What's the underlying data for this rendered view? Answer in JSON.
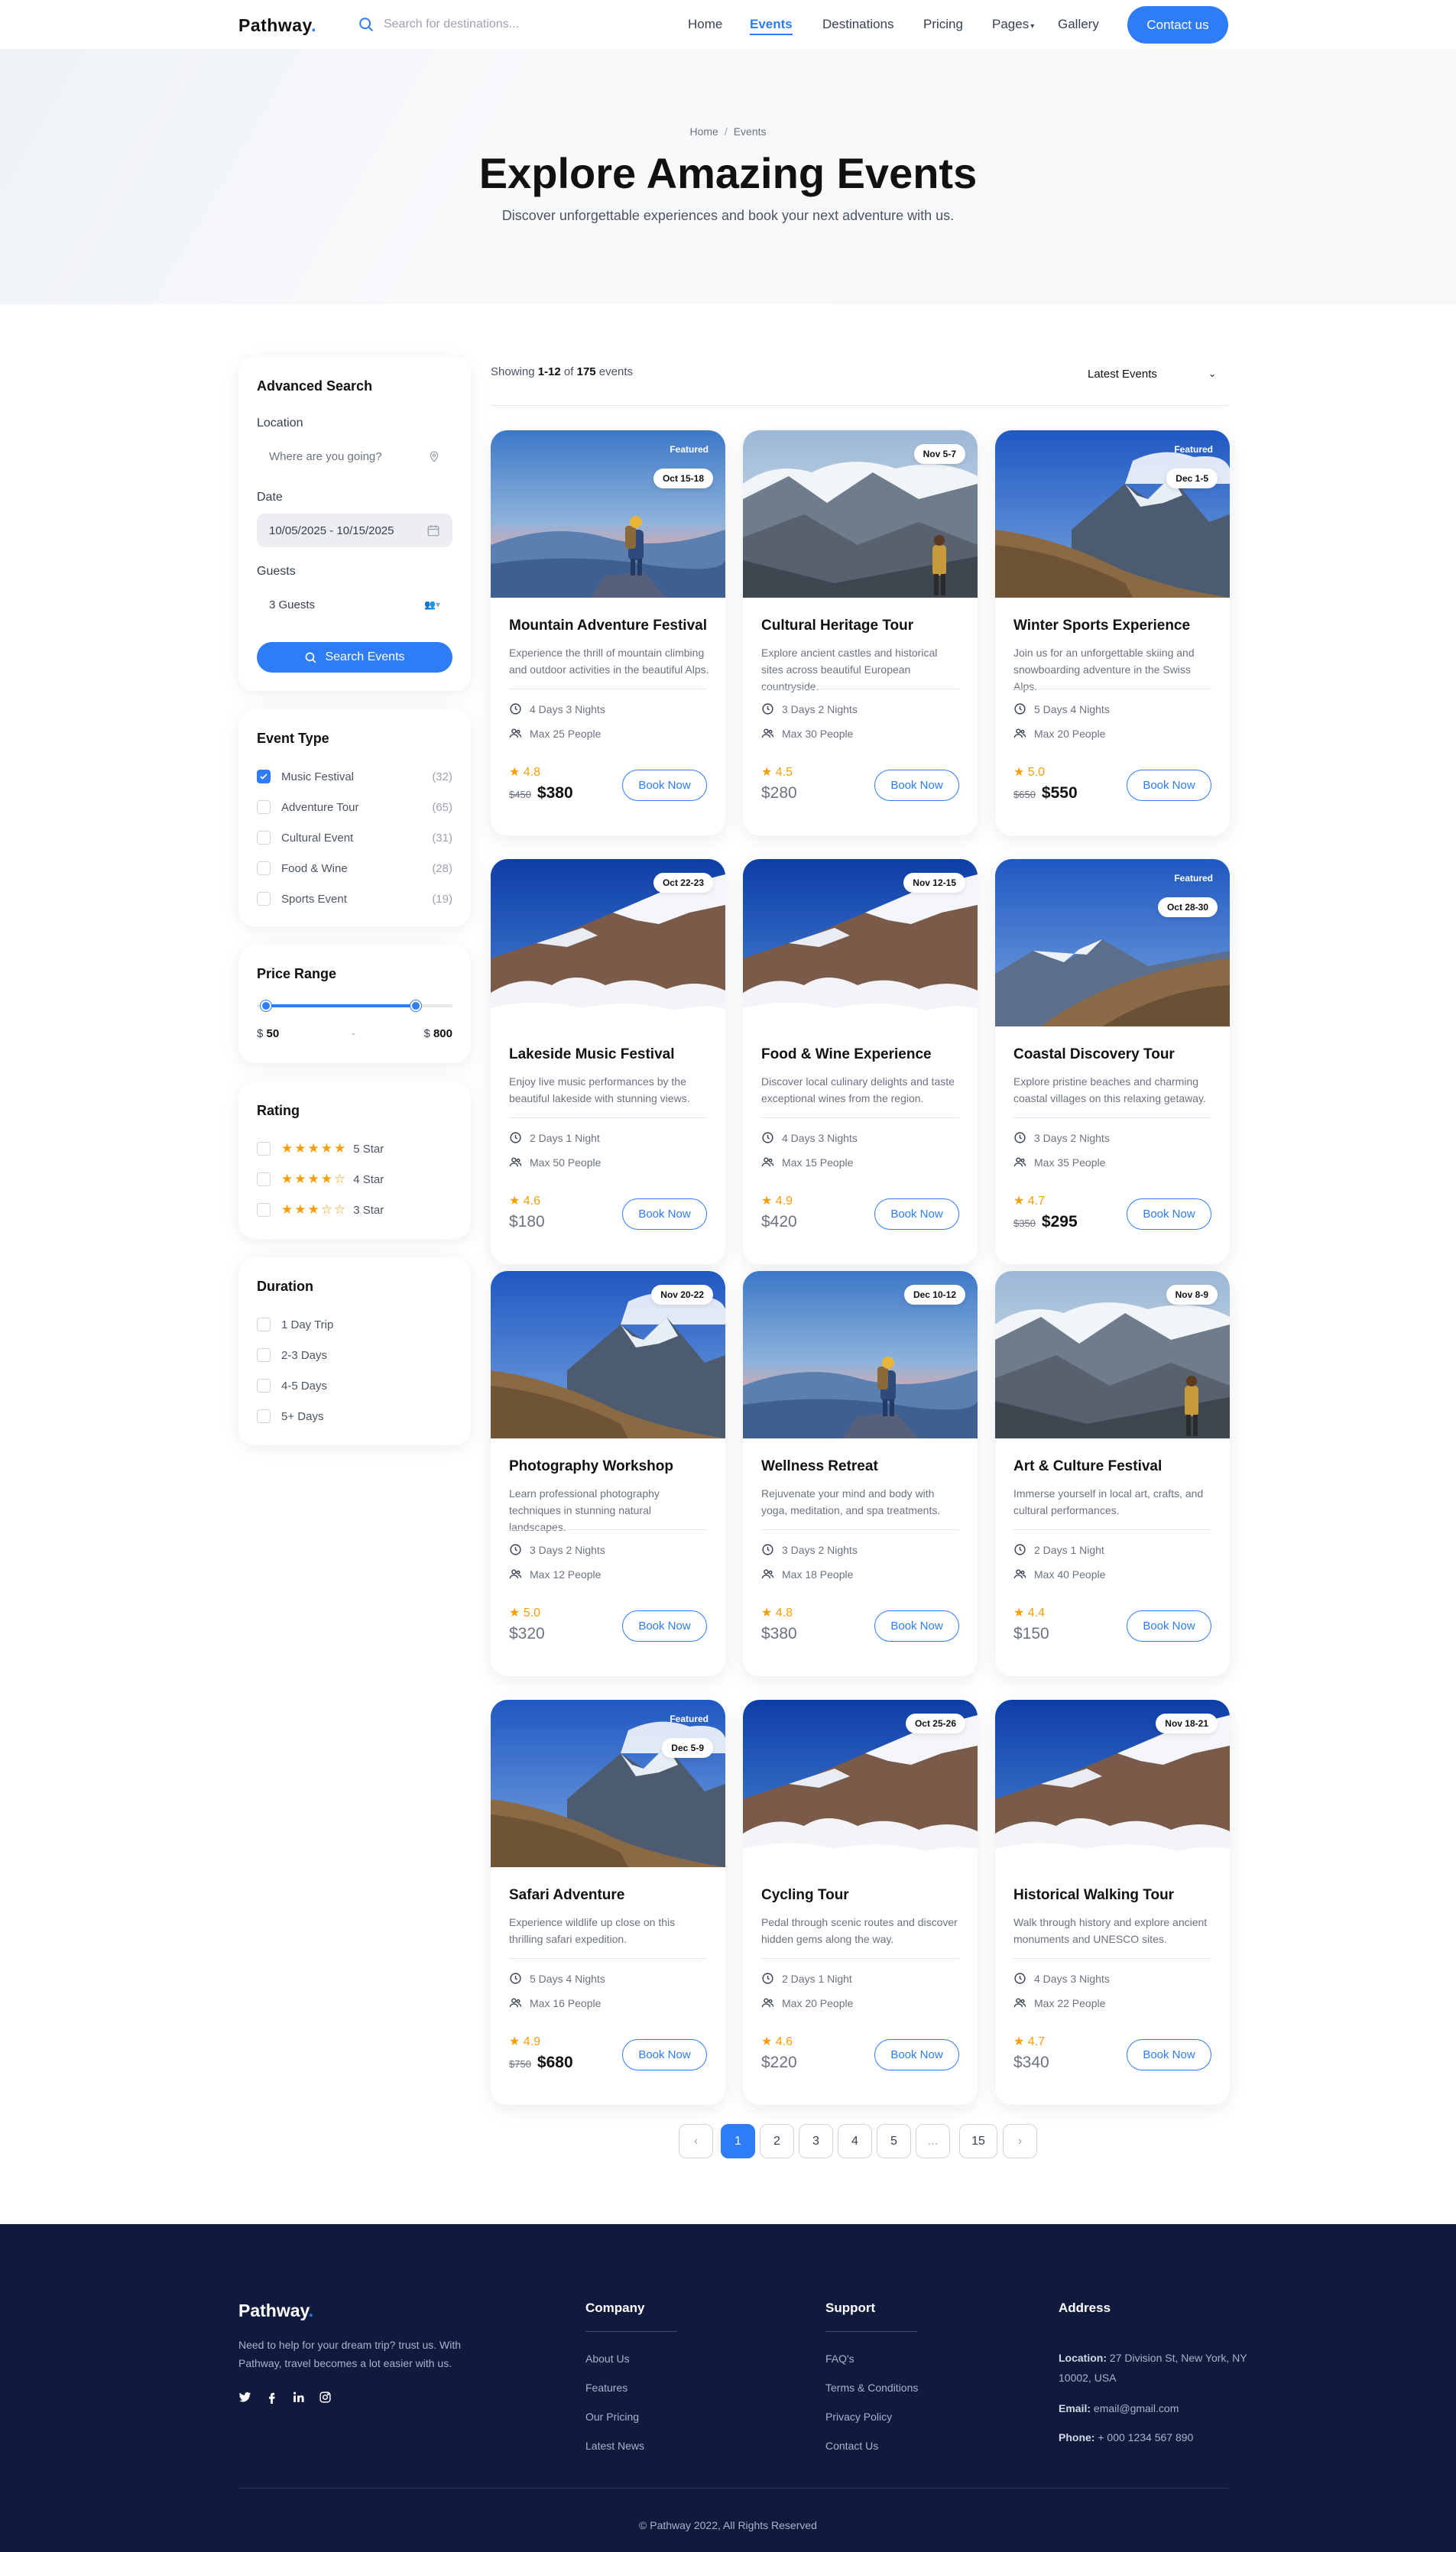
{
  "header": {
    "logo": "Pathway",
    "logo_dot": ".",
    "search_placeholder": "Search for destinations...",
    "nav": [
      "Home",
      "Events",
      "Destinations",
      "Pricing",
      "Pages",
      "Gallery"
    ],
    "contact_label": "Contact us"
  },
  "hero": {
    "breadcrumb_home": "Home",
    "breadcrumb_sep": "/",
    "breadcrumb_current": "Events",
    "title": "Explore Amazing Events",
    "subtitle": "Discover unforgettable experiences and book your next adventure with us."
  },
  "sidebar": {
    "search": {
      "title": "Advanced Search",
      "location_label": "Location",
      "location_placeholder": "Where are you going?",
      "date_label": "Date",
      "date_value": "10/05/2025 - 10/15/2025",
      "guests_label": "Guests",
      "guests_value": "3 Guests",
      "button": "Search Events"
    },
    "event_type": {
      "title": "Event Type",
      "items": [
        {
          "label": "Music Festival",
          "count": "(32)",
          "checked": true
        },
        {
          "label": "Adventure Tour",
          "count": "(65)",
          "checked": false
        },
        {
          "label": "Cultural Event",
          "count": "(31)",
          "checked": false
        },
        {
          "label": "Food & Wine",
          "count": "(28)",
          "checked": false
        },
        {
          "label": "Sports Event",
          "count": "(19)",
          "checked": false
        }
      ]
    },
    "price": {
      "title": "Price Range",
      "currency": "$",
      "min": "50",
      "max": "800",
      "dash": "-"
    },
    "rating": {
      "title": "Rating",
      "items": [
        {
          "label": "5 Star",
          "stars": 5
        },
        {
          "label": "4 Star",
          "stars": 4
        },
        {
          "label": "3 Star",
          "stars": 3
        }
      ]
    },
    "duration": {
      "title": "Duration",
      "items": [
        "1 Day Trip",
        "2-3 Days",
        "4-5 Days",
        "5+ Days"
      ]
    }
  },
  "results": {
    "showing_prefix": "Showing ",
    "range": "1-12",
    "of": " of ",
    "total": "175",
    "suffix": " events",
    "sort_value": "Latest Events"
  },
  "cards": [
    {
      "title": "Mountain Adventure Festival",
      "desc": "Experience the thrill of mountain climbing and outdoor activities in the beautiful Alps.",
      "date": "Oct 15-18",
      "featured": "Featured",
      "duration": "4 Days 3 Nights",
      "people": "Max 25 People",
      "rating": "4.8",
      "old_price": "$450",
      "price": "$380",
      "book": "Book Now",
      "img": "hiker-sunset"
    },
    {
      "title": "Cultural Heritage Tour",
      "desc": "Explore ancient castles and historical sites across beautiful European countryside.",
      "date": "Nov 5-7",
      "featured": "",
      "duration": "3 Days 2 Nights",
      "people": "Max 30 People",
      "rating": "4.5",
      "old_price": "",
      "price": "$280",
      "book": "Book Now",
      "img": "valley-hiker"
    },
    {
      "title": "Winter Sports Experience",
      "desc": "Join us for an unforgettable skiing and snowboarding adventure in the Swiss Alps.",
      "date": "Dec 1-5",
      "featured": "Featured",
      "duration": "5 Days 4 Nights",
      "people": "Max 20 People",
      "rating": "5.0",
      "old_price": "$650",
      "price": "$550",
      "book": "Book Now",
      "img": "peak-slope"
    },
    {
      "title": "Lakeside Music Festival",
      "desc": "Enjoy live music performances by the beautiful lakeside with stunning views.",
      "date": "Oct 22-23",
      "featured": "",
      "duration": "2 Days 1 Night",
      "people": "Max 50 People",
      "rating": "4.6",
      "old_price": "",
      "price": "$180",
      "book": "Book Now",
      "img": "snow-clouds"
    },
    {
      "title": "Food & Wine Experience",
      "desc": "Discover local culinary delights and taste exceptional wines from the region.",
      "date": "Nov 12-15",
      "featured": "",
      "duration": "4 Days 3 Nights",
      "people": "Max 15 People",
      "rating": "4.9",
      "old_price": "",
      "price": "$420",
      "book": "Book Now",
      "img": "snow-clouds"
    },
    {
      "title": "Coastal Discovery Tour",
      "desc": "Explore pristine beaches and charming coastal villages on this relaxing getaway.",
      "date": "Oct 28-30",
      "featured": "Featured",
      "duration": "3 Days 2 Nights",
      "people": "Max 35 People",
      "rating": "4.7",
      "old_price": "$350",
      "price": "$295",
      "book": "Book Now",
      "img": "ridge-blue"
    },
    {
      "title": "Photography Workshop",
      "desc": "Learn professional photography techniques in stunning natural landscapes.",
      "date": "Nov 20-22",
      "featured": "",
      "duration": "3 Days 2 Nights",
      "people": "Max 12 People",
      "rating": "5.0",
      "old_price": "",
      "price": "$320",
      "book": "Book Now",
      "img": "peak-slope"
    },
    {
      "title": "Wellness Retreat",
      "desc": "Rejuvenate your mind and body with yoga, meditation, and spa treatments.",
      "date": "Dec 10-12",
      "featured": "",
      "duration": "3 Days 2 Nights",
      "people": "Max 18 People",
      "rating": "4.8",
      "old_price": "",
      "price": "$380",
      "book": "Book Now",
      "img": "hiker-sunset"
    },
    {
      "title": "Art & Culture Festival",
      "desc": "Immerse yourself in local art, crafts, and cultural performances.",
      "date": "Nov 8-9",
      "featured": "",
      "duration": "2 Days 1 Night",
      "people": "Max 40 People",
      "rating": "4.4",
      "old_price": "",
      "price": "$150",
      "book": "Book Now",
      "img": "valley-hiker"
    },
    {
      "title": "Safari Adventure",
      "desc": "Experience wildlife up close on this thrilling safari expedition.",
      "date": "Dec 5-9",
      "featured": "Featured",
      "duration": "5 Days 4 Nights",
      "people": "Max 16 People",
      "rating": "4.9",
      "old_price": "$750",
      "price": "$680",
      "book": "Book Now",
      "img": "peak-slope"
    },
    {
      "title": "Cycling Tour",
      "desc": "Pedal through scenic routes and discover hidden gems along the way.",
      "date": "Oct 25-26",
      "featured": "",
      "duration": "2 Days 1 Night",
      "people": "Max 20 People",
      "rating": "4.6",
      "old_price": "",
      "price": "$220",
      "book": "Book Now",
      "img": "snow-clouds"
    },
    {
      "title": "Historical Walking Tour",
      "desc": "Walk through history and explore ancient monuments and UNESCO sites.",
      "date": "Nov 18-21",
      "featured": "",
      "duration": "4 Days 3 Nights",
      "people": "Max 22 People",
      "rating": "4.7",
      "old_price": "",
      "price": "$340",
      "book": "Book Now",
      "img": "snow-clouds"
    }
  ],
  "pagination": {
    "items": [
      "‹",
      "1",
      "2",
      "3",
      "4",
      "5",
      "...",
      "15",
      "›"
    ],
    "current": "1"
  },
  "footer": {
    "logo": "Pathway",
    "logo_dot": ".",
    "desc": "Need to help for your dream trip? trust us. With Pathway, travel becomes a lot easier with us.",
    "social": [
      "twitter-icon",
      "facebook-icon",
      "linkedin-icon",
      "instagram-icon"
    ],
    "company": {
      "title": "Company",
      "links": [
        "About Us",
        "Features",
        "Our Pricing",
        "Latest News"
      ]
    },
    "support": {
      "title": "Support",
      "links": [
        "FAQ's",
        "Terms & Conditions",
        "Privacy Policy",
        "Contact Us"
      ]
    },
    "address": {
      "title": "Address",
      "location_label": "Location:",
      "location": " 27 Division St, New York, NY 10002, USA",
      "email_label": "Email:",
      "email": " email@gmail.com",
      "phone_label": "Phone:",
      "phone": " + 000 1234 567 890"
    },
    "copyright": "© Pathway 2022, All Rights Reserved"
  },
  "colors": {
    "accent": "#2e7cf6",
    "footer_bg": "#101a3c",
    "star": "#f59e0b"
  }
}
